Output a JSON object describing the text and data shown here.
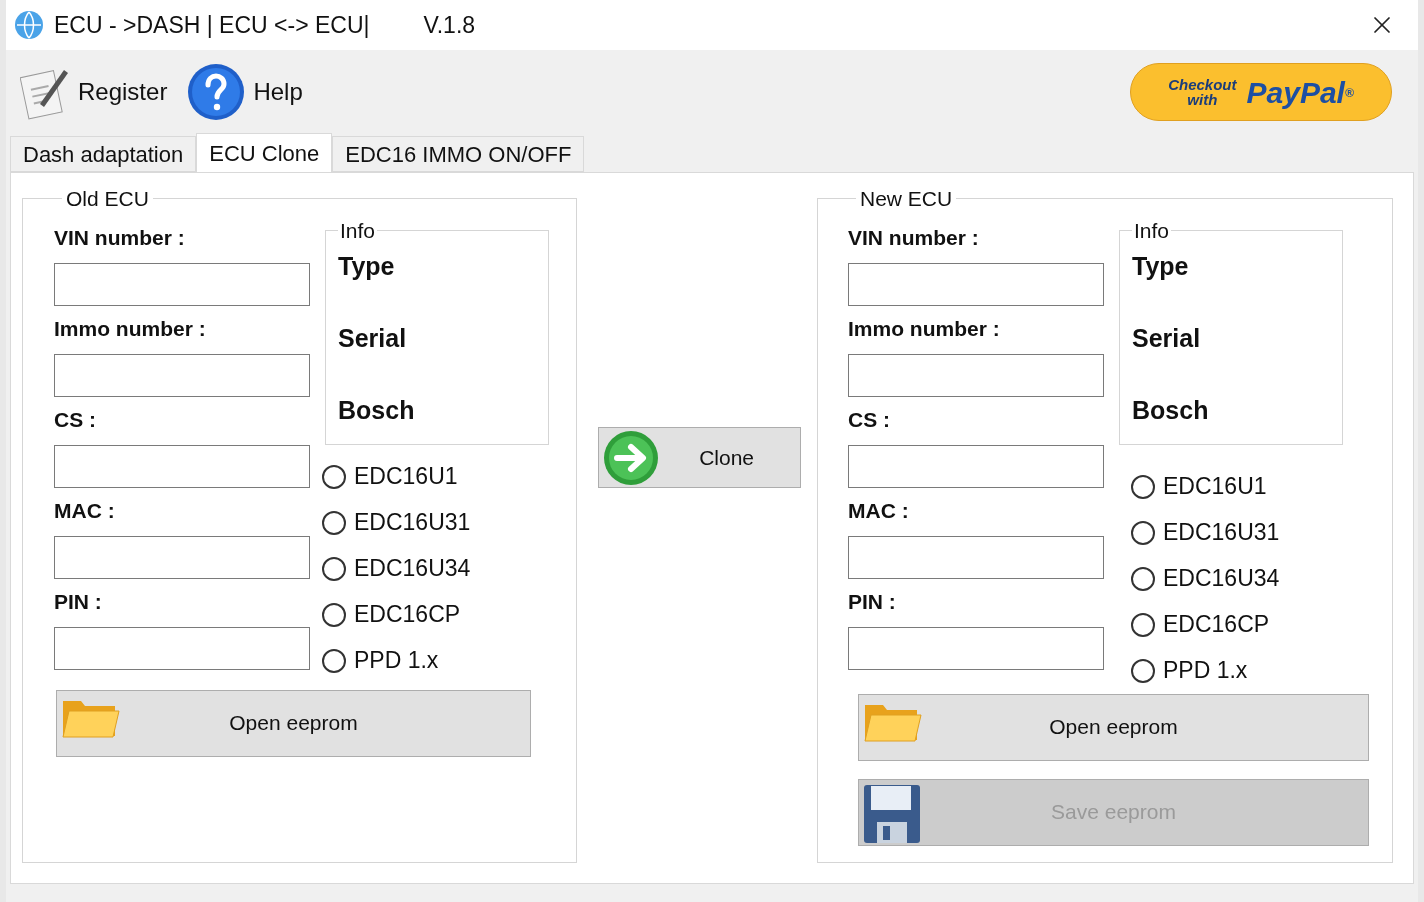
{
  "window": {
    "title": "ECU - >DASH | ECU <-> ECU|",
    "version": "V.1.8"
  },
  "toolbar": [
    {
      "label": "Register",
      "kind": "register"
    },
    {
      "label": "Help",
      "kind": "help"
    }
  ],
  "paypal": {
    "checkout": "Checkout",
    "with": "with",
    "brand": "PayPal",
    "mark": "®"
  },
  "tabs": [
    {
      "label": "Dash adaptation",
      "selected": false
    },
    {
      "label": "ECU Clone",
      "selected": true
    },
    {
      "label": "EDC16 IMMO ON/OFF",
      "selected": false
    }
  ],
  "groups": [
    {
      "title": "Old ECU",
      "fields": [
        "VIN number :",
        "Immo number :",
        "CS :",
        "MAC :",
        "PIN :"
      ],
      "info": {
        "title": "Info",
        "lines": [
          "Type",
          "Serial",
          "Bosch"
        ]
      },
      "radios": [
        {
          "label": "EDC16U1",
          "selected": false
        },
        {
          "label": "EDC16U31",
          "selected": false
        },
        {
          "label": "EDC16U34",
          "selected": false
        },
        {
          "label": "EDC16CP",
          "selected": false
        },
        {
          "label": "PPD 1.x",
          "selected": false
        }
      ],
      "buttons": [
        {
          "label": "Open eeprom",
          "kind": "open",
          "disabled": false
        }
      ]
    },
    {
      "title": "New ECU",
      "fields": [
        "VIN number :",
        "Immo number :",
        "CS :",
        "MAC :",
        "PIN :"
      ],
      "info": {
        "title": "Info",
        "lines": [
          "Type",
          "Serial",
          "Bosch"
        ]
      },
      "radios": [
        {
          "label": "EDC16U1",
          "selected": false
        },
        {
          "label": "EDC16U31",
          "selected": false
        },
        {
          "label": "EDC16U34",
          "selected": false
        },
        {
          "label": "EDC16CP",
          "selected": false
        },
        {
          "label": "PPD 1.x",
          "selected": false
        }
      ],
      "buttons": [
        {
          "label": "Open eeprom",
          "kind": "open",
          "disabled": false
        },
        {
          "label": "Save eeprom",
          "kind": "save",
          "disabled": true
        }
      ]
    }
  ],
  "clone": {
    "label": "Clone"
  }
}
